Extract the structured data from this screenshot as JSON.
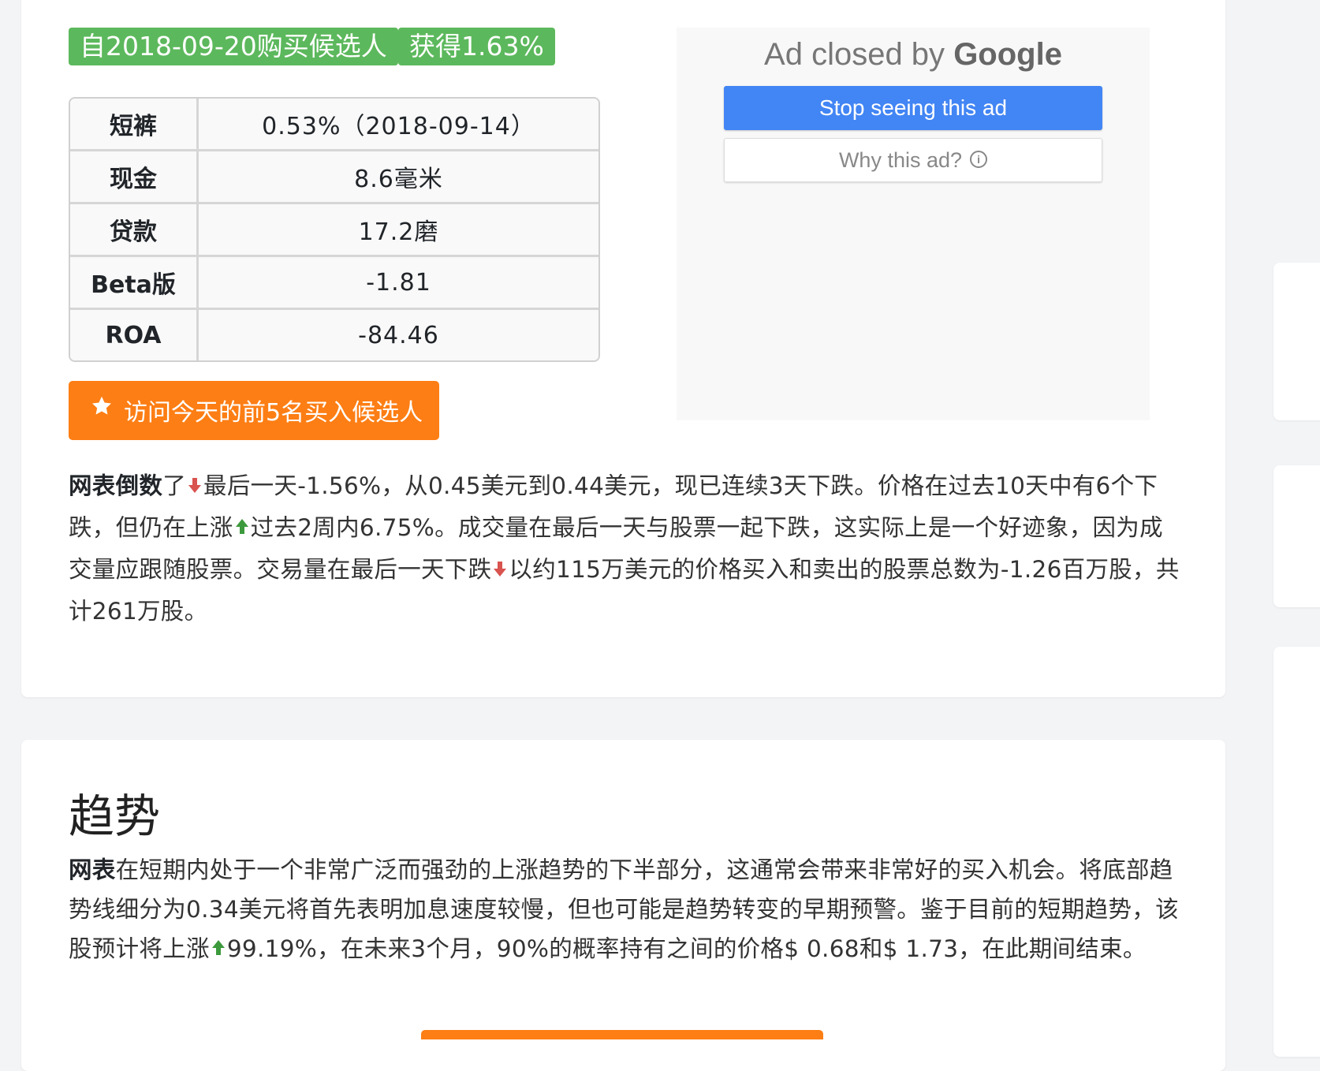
{
  "badges": {
    "buy_candidate": "自2018-09-20购买候选人",
    "gain": "获得1.63%"
  },
  "stats_table": {
    "rows": [
      {
        "key": "短裤",
        "value": "0.53%（2018-09-14）"
      },
      {
        "key": "现金",
        "value": "8.6毫米"
      },
      {
        "key": "贷款",
        "value": "17.2磨"
      },
      {
        "key": "Beta版",
        "value": "-1.81"
      },
      {
        "key": "ROA",
        "value": "-84.46"
      }
    ]
  },
  "top5_button": {
    "icon": "star-icon",
    "label": "访问今天的前5名买入候选人"
  },
  "ad": {
    "closed_prefix": "Ad closed by",
    "closed_brand": "Google",
    "stop_label": "Stop seeing this ad",
    "why_label": "Why this ad?",
    "why_icon": "info-icon"
  },
  "summary": {
    "subject": "网表倒数",
    "t1": "了",
    "t2": "最后一天-1.56%，从0.45美元到0.44美元，现已连续3天下跌。价格在过去10天中有6个下跌，但仍在上涨",
    "t3": "过去2周内6.75%。成交量在最后一天与股票一起下跌，这实际上是一个好迹象，因为成交量应跟随股票。交易量在最后一天下跌",
    "t4": "以约115万美元的价格买入和卖出的股票总数为-1.26百万股，共计261万股。"
  },
  "trend": {
    "title": "趋势",
    "subject": "网表",
    "t1": "在短期内处于一个非常广泛而强劲的上涨趋势的下半部分，这通常会带来非常好的买入机会。将底部趋势线细分为0.34美元将首先表明加息速度较慢，但也可能是趋势转变的早期预警。鉴于目前的短期趋势，该股预计将上涨",
    "t2": "99.19%，在未来3个月，90%的概率持有之间的价格$ 0.68和$ 1.73，在此期间结束。"
  },
  "colors": {
    "badge_green": "#5cb85c",
    "button_orange": "#fd7e14",
    "ad_blue": "#4285f4",
    "arrow_down": "#d9534f",
    "arrow_up": "#3c9a3c"
  }
}
